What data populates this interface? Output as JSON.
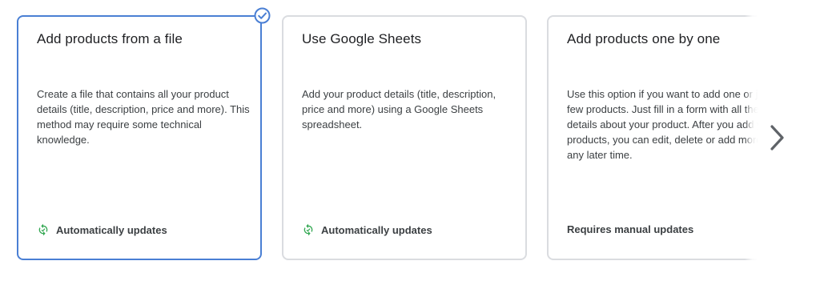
{
  "cards": [
    {
      "title": "Add products from a file",
      "description": "Create a file that contains all your product details (title, description, price and more). This method may require some technical knowledge.",
      "footer": "Automatically updates",
      "footer_icon": "sync-icon",
      "selected": true
    },
    {
      "title": "Use Google Sheets",
      "description": "Add your product details (title, description, price and more) using a Google Sheets spreadsheet.",
      "footer": "Automatically updates",
      "footer_icon": "sync-icon",
      "selected": false
    },
    {
      "title": "Add products one by one",
      "description": "Use this option if you want to add one or just a few products. Just fill in a form with all the details about your product. After you add your products, you can edit, delete or add more at any later time.",
      "footer": "Requires manual updates",
      "selected": false
    }
  ],
  "carousel": {
    "next_icon": "chevron-right-icon"
  },
  "colors": {
    "selected_border": "#4a7fd4",
    "card_border": "#dadce0",
    "sync_icon": "#34a853",
    "check_badge": "#4a7fd4"
  }
}
